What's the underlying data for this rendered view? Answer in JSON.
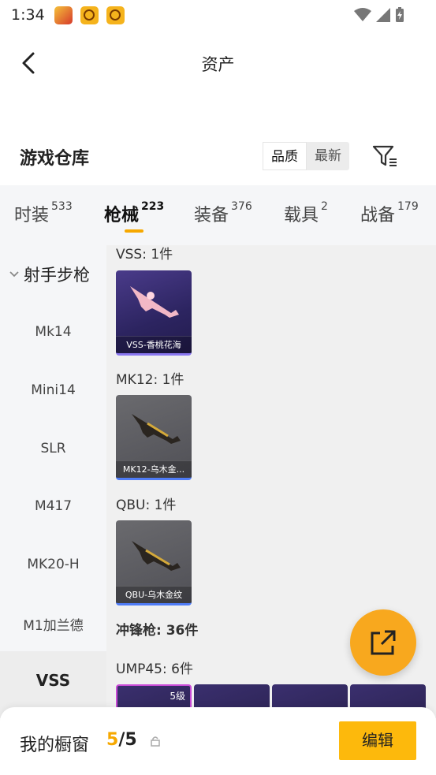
{
  "status_bar": {
    "time": "1:34"
  },
  "header": {
    "title": "资产"
  },
  "warehouse": {
    "title": "游戏仓库",
    "sort_options": [
      "品质",
      "最新"
    ]
  },
  "tabs": [
    {
      "label": "时装",
      "count": "533"
    },
    {
      "label": "枪械",
      "count": "223"
    },
    {
      "label": "装备",
      "count": "376"
    },
    {
      "label": "载具",
      "count": "2"
    },
    {
      "label": "战备",
      "count": "179"
    }
  ],
  "sidebar": {
    "group": "射手步枪",
    "items": [
      "Mk14",
      "Mini14",
      "SLR",
      "M417",
      "MK20-H",
      "M1加兰德"
    ],
    "active": "VSS"
  },
  "content": {
    "sections": [
      {
        "label": "VSS: 1件",
        "item_name": "VSS-香桃花海"
      },
      {
        "label": "MK12: 1件",
        "item_name": "MK12-乌木金..."
      },
      {
        "label": "QBU: 1件",
        "item_name": "QBU-乌木金纹"
      }
    ],
    "category_label": "冲锋枪: 36件",
    "ump_label": "UMP45: 6件",
    "ump_first_level": "5级"
  },
  "bottom_bar": {
    "label": "我的橱窗",
    "current": "5",
    "total": "/5",
    "edit_label": "编辑"
  },
  "colors": {
    "accent": "#f6a800",
    "edit_button": "#fdb90c",
    "fab": "#f8a81e"
  }
}
